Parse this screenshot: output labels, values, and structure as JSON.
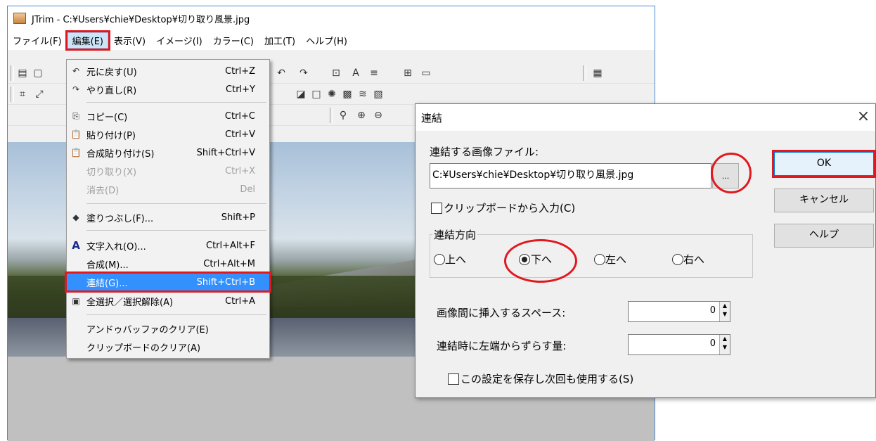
{
  "window": {
    "title": "JTrim - C:¥Users¥chie¥Desktop¥切り取り風景.jpg"
  },
  "menubar": [
    "ファイル(F)",
    "編集(E)",
    "表示(V)",
    "イメージ(I)",
    "カラー(C)",
    "加工(T)",
    "ヘルプ(H)"
  ],
  "edit_menu": {
    "items": [
      {
        "label": "元に戻す(U)",
        "shortcut": "Ctrl+Z",
        "icon": "undo-icon",
        "glyph": "↶"
      },
      {
        "label": "やり直し(R)",
        "shortcut": "Ctrl+Y",
        "icon": "redo-icon",
        "glyph": "↷"
      },
      {
        "label": "コピー(C)",
        "shortcut": "Ctrl+C",
        "icon": "copy-icon",
        "glyph": "⎘"
      },
      {
        "label": "貼り付け(P)",
        "shortcut": "Ctrl+V",
        "icon": "paste-icon",
        "glyph": "📋"
      },
      {
        "label": "合成貼り付け(S)",
        "shortcut": "Shift+Ctrl+V",
        "icon": "composite-paste-icon",
        "glyph": "📋"
      },
      {
        "label": "切り取り(X)",
        "shortcut": "Ctrl+X",
        "icon": "",
        "glyph": "",
        "disabled": true
      },
      {
        "label": "消去(D)",
        "shortcut": "Del",
        "icon": "",
        "glyph": "",
        "disabled": true
      },
      {
        "label": "塗りつぶし(F)...",
        "shortcut": "Shift+P",
        "icon": "fill-bucket-icon",
        "glyph": "◆"
      },
      {
        "label": "文字入れ(O)...",
        "shortcut": "Ctrl+Alt+F",
        "icon": "text-icon",
        "glyph": "A"
      },
      {
        "label": "合成(M)...",
        "shortcut": "Ctrl+Alt+M",
        "icon": "",
        "glyph": ""
      },
      {
        "label": "連結(G)...",
        "shortcut": "Shift+Ctrl+B",
        "icon": "",
        "glyph": "",
        "highlighted": true
      },
      {
        "label": "全選択／選択解除(A)",
        "shortcut": "Ctrl+A",
        "icon": "select-all-icon",
        "glyph": "▣"
      },
      {
        "label": "アンドゥバッファのクリア(E)",
        "shortcut": "",
        "icon": "",
        "glyph": ""
      },
      {
        "label": "クリップボードのクリア(A)",
        "shortcut": "",
        "icon": "",
        "glyph": ""
      }
    ]
  },
  "dialog": {
    "title": "連結",
    "close_glyph": "×",
    "file_label": "連結する画像ファイル:",
    "file_value": "C:¥Users¥chie¥Desktop¥切り取り風景.jpg",
    "browse_label": "...",
    "clipboard_label": "クリップボードから入力(C)",
    "direction_group": "連結方向",
    "directions": [
      "上へ",
      "下へ",
      "左へ",
      "右へ"
    ],
    "selected_direction": "下へ",
    "space_label": "画像間に挿入するスペース:",
    "space_value": "0",
    "offset_label": "連結時に左端からずらす量:",
    "offset_value": "0",
    "save_label": "この設定を保存し次回も使用する(S)",
    "ok": "OK",
    "cancel": "キャンセル",
    "help": "ヘルプ"
  },
  "colors": {
    "highlight_red": "#e0191f",
    "menu_select_blue": "#3390ff"
  }
}
